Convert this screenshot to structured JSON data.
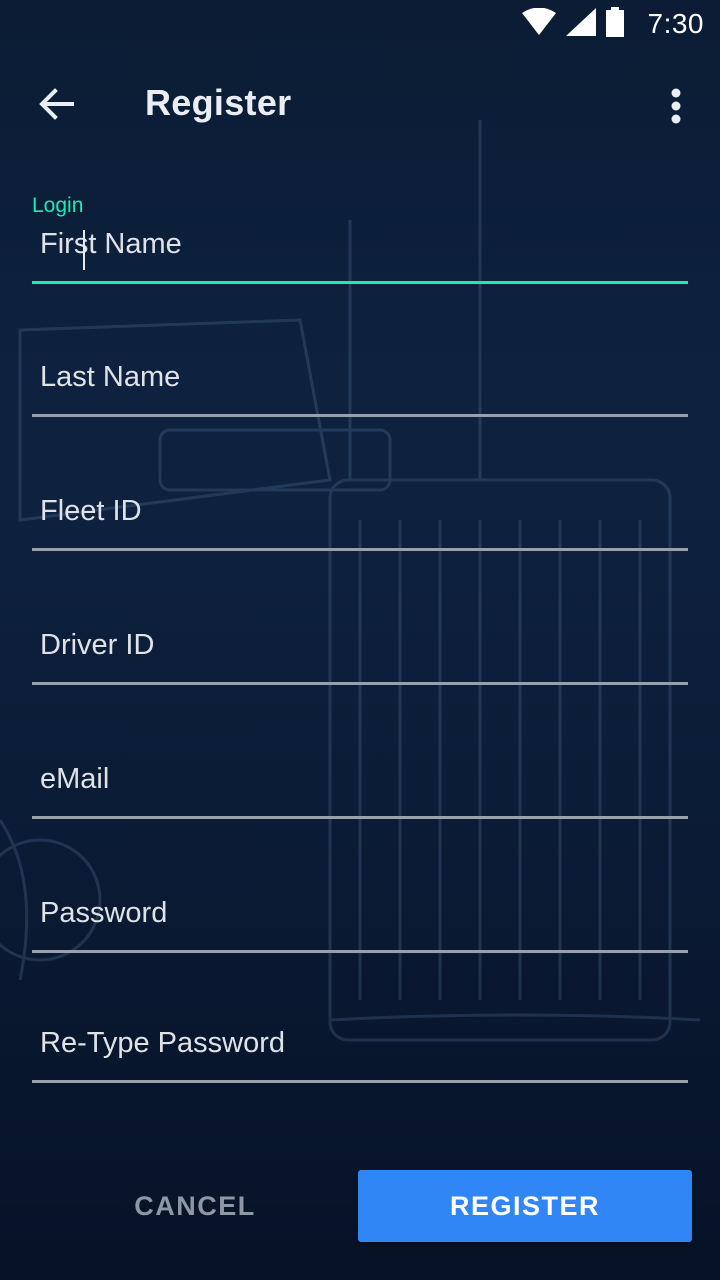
{
  "status_bar": {
    "time": "7:30",
    "icons": [
      "wifi-icon",
      "signal-icon",
      "battery-icon"
    ]
  },
  "app_bar": {
    "title": "Register",
    "back_icon": "arrow-left-icon",
    "menu_icon": "more-vert-icon"
  },
  "form": {
    "first_name": {
      "label": "Login",
      "placeholder": "First Name",
      "value": ""
    },
    "last_name": {
      "placeholder": "Last Name",
      "value": ""
    },
    "fleet_id": {
      "placeholder": "Fleet ID",
      "value": ""
    },
    "driver_id": {
      "placeholder": "Driver ID",
      "value": ""
    },
    "email": {
      "placeholder": "eMail",
      "value": ""
    },
    "password": {
      "placeholder": "Password",
      "value": ""
    },
    "retype_password": {
      "placeholder": "Re-Type Password",
      "value": ""
    }
  },
  "actions": {
    "cancel_label": "CANCEL",
    "register_label": "REGISTER"
  },
  "colors": {
    "accent": "#1de9b6",
    "primary_button": "#2f86f4",
    "background": "#0e2240",
    "underline": "#9aa0a8"
  }
}
